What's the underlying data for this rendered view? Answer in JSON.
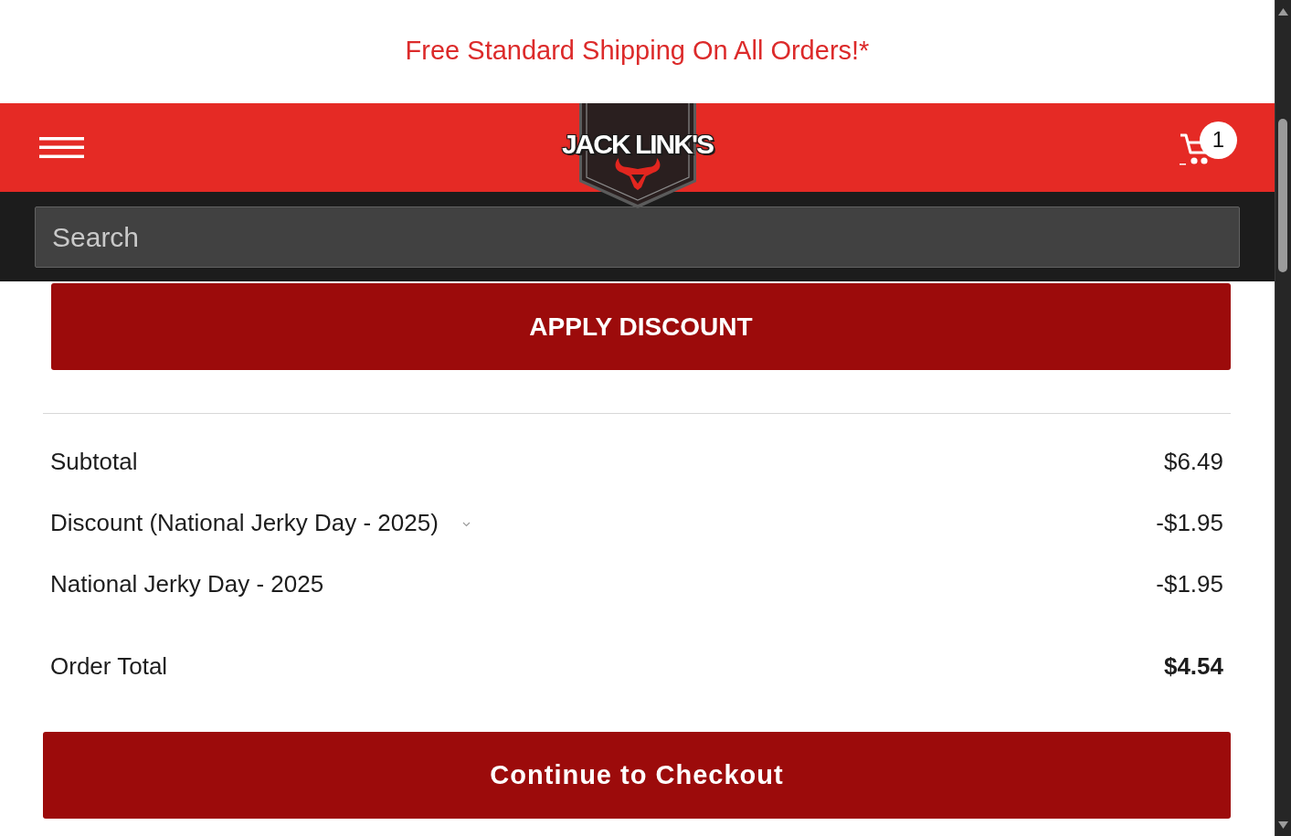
{
  "promo_banner": {
    "text": "Free Standard Shipping On All Orders!*"
  },
  "header": {
    "logo": {
      "wordmark": "JACK LINK'S"
    },
    "cart": {
      "count": "1"
    }
  },
  "search": {
    "placeholder": "Search"
  },
  "discount_button": {
    "label": "APPLY DISCOUNT"
  },
  "summary": {
    "rows": [
      {
        "kind": "line",
        "label": "Subtotal",
        "value": "$6.49"
      },
      {
        "kind": "toggle",
        "label": "Discount (National Jerky Day - 2025)",
        "value": "-$1.95",
        "expanded": true,
        "children": [
          {
            "label": "National Jerky Day - 2025",
            "value": "-$1.95"
          }
        ]
      },
      {
        "kind": "total",
        "label": "Order Total",
        "value": "$4.54"
      }
    ]
  },
  "checkout_button": {
    "label": "Continue to Checkout"
  }
}
